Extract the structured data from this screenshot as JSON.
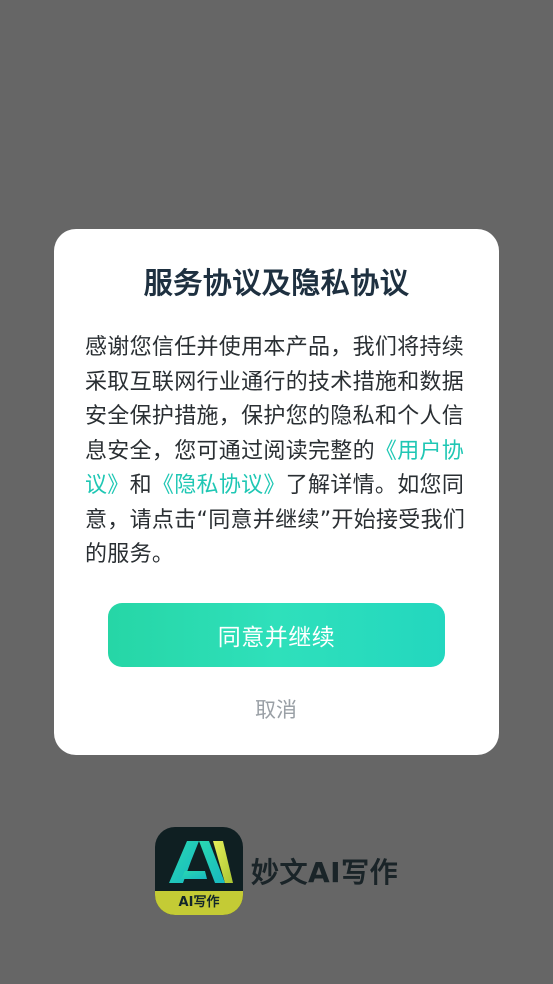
{
  "dialog": {
    "title": "服务协议及隐私协议",
    "body": {
      "intro": "感谢您信任并使用本产品，我们将持续采取互联网行业通行的技术措施和数据安全保护措施，保护您的隐私和个人信息安全，您可通过阅读完整的",
      "user_agreement_link": "《用户协议》",
      "conjunction": "和",
      "privacy_link": "《隐私协议》",
      "outro": "了解详情。如您同意，请点击“同意并继续”开始接受我们的服务。"
    },
    "confirm_label": "同意并继续",
    "cancel_label": "取消"
  },
  "brand": {
    "icon_label": "AI写作",
    "name": "妙文AI写作"
  },
  "colors": {
    "overlay": "#666666",
    "link": "#1fc7b4",
    "button_gradient_start": "#26d6a6",
    "button_gradient_end": "#23d7bf",
    "icon_badge": "#c4cb35"
  }
}
